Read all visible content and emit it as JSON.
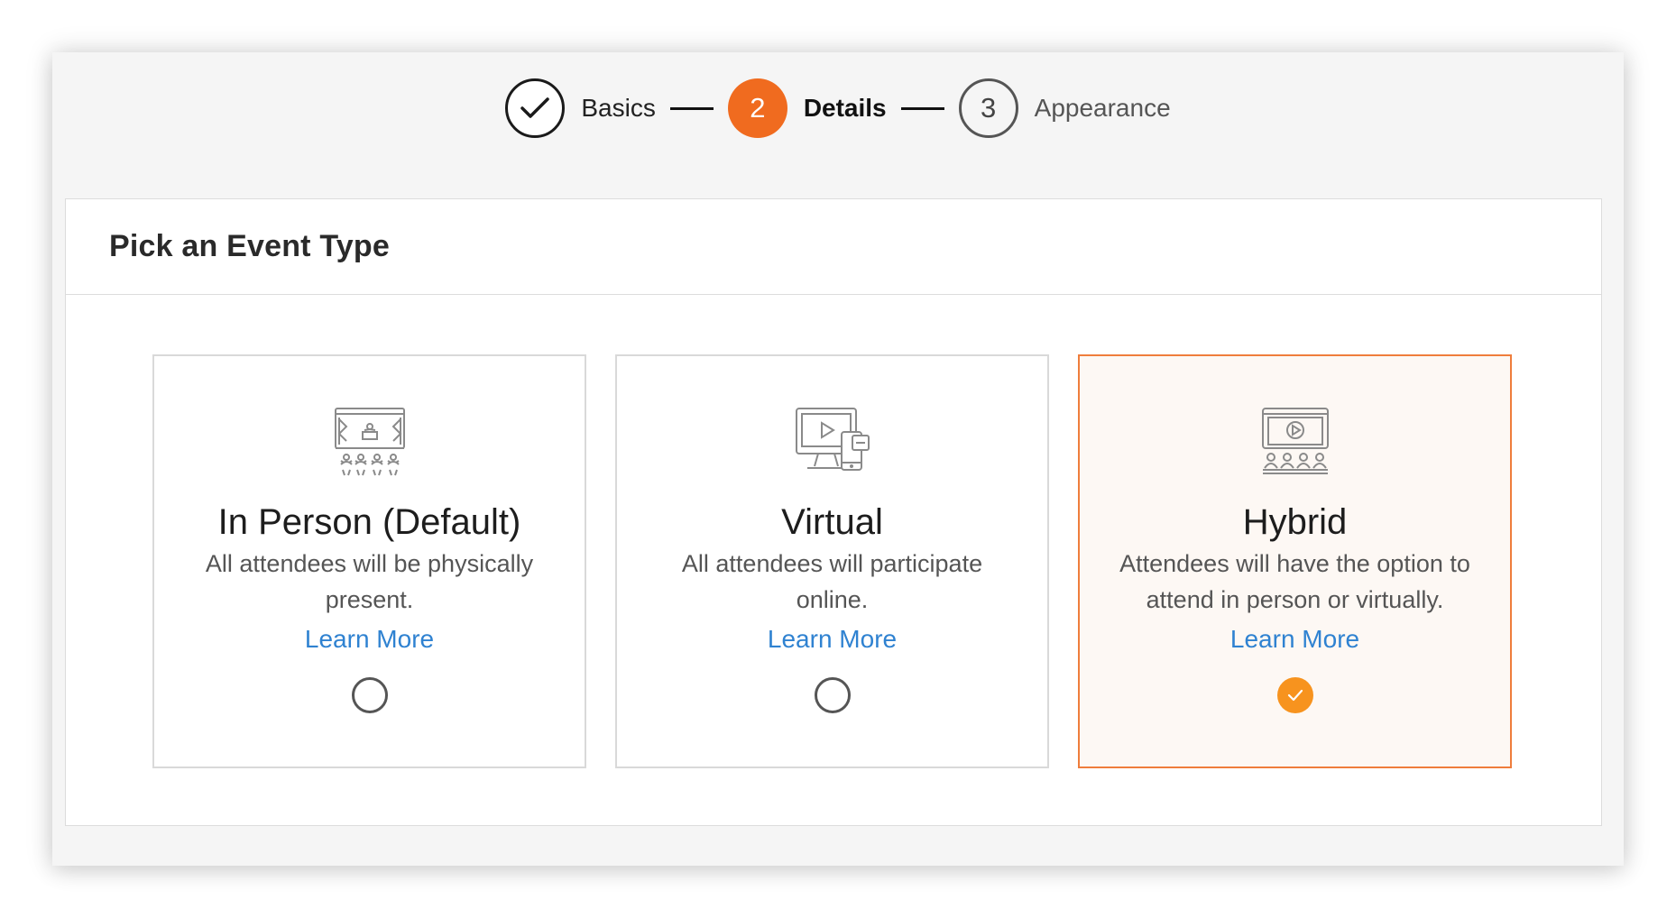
{
  "stepper": {
    "steps": [
      {
        "label": "Basics",
        "number": "",
        "state": "done"
      },
      {
        "label": "Details",
        "number": "2",
        "state": "active"
      },
      {
        "label": "Appearance",
        "number": "3",
        "state": "todo"
      }
    ]
  },
  "panel": {
    "title": "Pick an Event Type"
  },
  "options": [
    {
      "title": "In Person (Default)",
      "description": "All attendees will be physically present.",
      "link": "Learn More",
      "icon": "stage-audience-icon",
      "selected": false
    },
    {
      "title": "Virtual",
      "description": "All attendees will participate online.",
      "link": "Learn More",
      "icon": "devices-video-icon",
      "selected": false
    },
    {
      "title": "Hybrid",
      "description": "Attendees will have the option to attend in person or virtually.",
      "link": "Learn More",
      "icon": "screen-audience-icon",
      "selected": true
    }
  ],
  "colors": {
    "accent": "#f06b1f",
    "selected_border": "#ef7d3c",
    "checkbox": "#f7931e",
    "link": "#2f82d1"
  }
}
